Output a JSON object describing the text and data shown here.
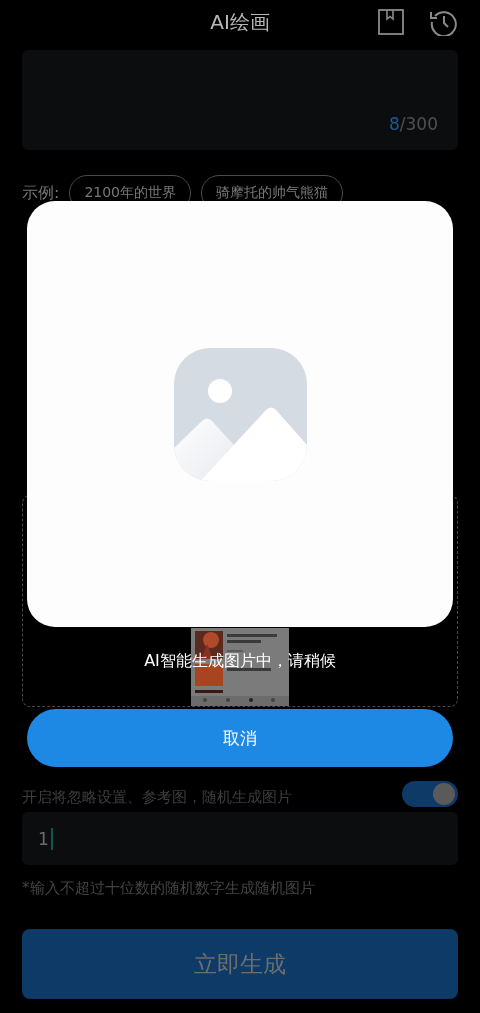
{
  "header": {
    "title": "AI绘画"
  },
  "prompt": {
    "count": "8",
    "limit": "/300"
  },
  "examples": {
    "label": "示例:",
    "chips": [
      "2100年的世界",
      "骑摩托的帅气熊猫"
    ]
  },
  "random": {
    "on": true,
    "hint": "开启将忽略设置、参考图，随机生成图片"
  },
  "seed": {
    "value": "1"
  },
  "note": "*输入不超过十位数的随机数字生成随机图片",
  "generate_button": "立即生成",
  "dialog": {
    "message": "AI智能生成图片中，请稍候",
    "cancel_button": "取消"
  }
}
